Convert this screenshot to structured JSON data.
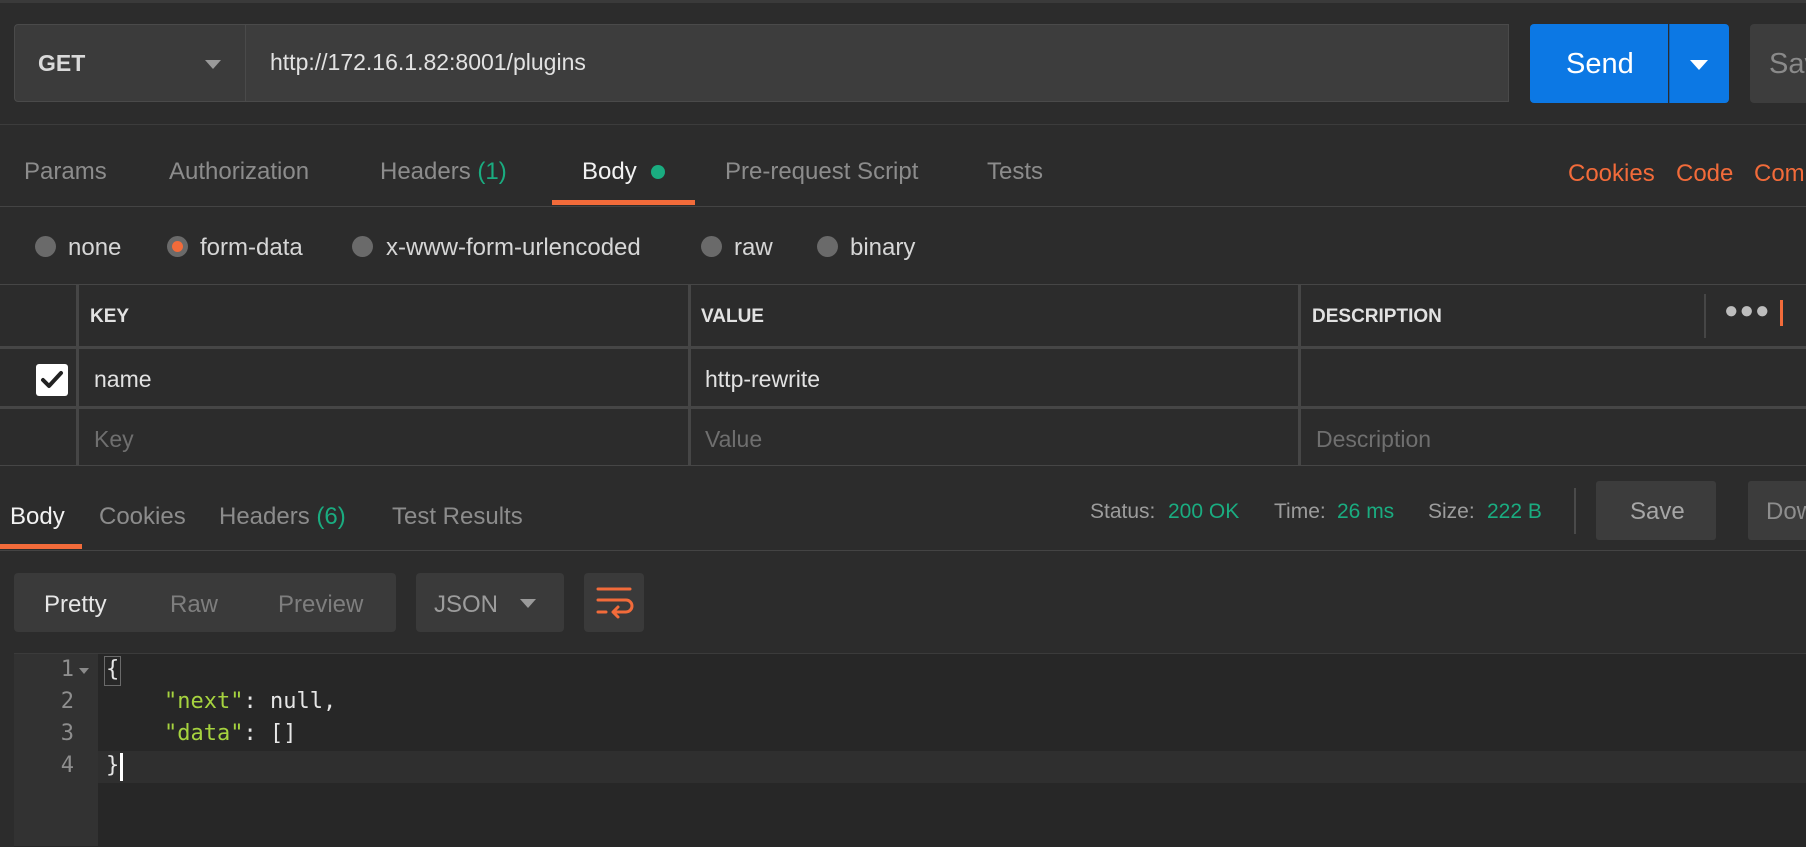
{
  "request": {
    "method": "GET",
    "url": "http://172.16.1.82:8001/plugins",
    "send_label": "Send",
    "save_label": "Save"
  },
  "request_tabs": {
    "params": "Params",
    "authorization": "Authorization",
    "headers": "Headers",
    "headers_count": "(1)",
    "body": "Body",
    "pre_request": "Pre-request Script",
    "tests": "Tests"
  },
  "right_links": {
    "cookies": "Cookies",
    "code": "Code",
    "comments": "Comments"
  },
  "body_types": {
    "selected": "form-data",
    "options": [
      "none",
      "form-data",
      "x-www-form-urlencoded",
      "raw",
      "binary"
    ]
  },
  "form_table": {
    "headers": {
      "key": "KEY",
      "value": "VALUE",
      "description": "DESCRIPTION"
    },
    "more_icon": "ellipsis-icon",
    "rows": [
      {
        "checked": true,
        "key": "name",
        "value": "http-rewrite",
        "description": ""
      }
    ],
    "placeholders": {
      "key": "Key",
      "value": "Value",
      "description": "Description"
    }
  },
  "response_tabs": {
    "body": "Body",
    "cookies": "Cookies",
    "headers": "Headers",
    "headers_count": "(6)",
    "test_results": "Test Results"
  },
  "status": {
    "status_label": "Status:",
    "status_value": "200 OK",
    "time_label": "Time:",
    "time_value": "26 ms",
    "size_label": "Size:",
    "size_value": "222 B"
  },
  "response_actions": {
    "save": "Save",
    "download": "Download"
  },
  "view_modes": {
    "pretty": "Pretty",
    "raw": "Raw",
    "preview": "Preview",
    "selected": "Pretty"
  },
  "format": {
    "selected": "JSON",
    "wrap_icon": "wrap-lines-icon"
  },
  "response_body": {
    "lines": [
      {
        "n": "1",
        "open": "{"
      },
      {
        "n": "2",
        "key": "\"next\"",
        "sep": ": ",
        "val": "null,"
      },
      {
        "n": "3",
        "key": "\"data\"",
        "sep": ": ",
        "val": "[]"
      },
      {
        "n": "4",
        "close": "}"
      }
    ]
  },
  "colors": {
    "background": "#2c2c2c",
    "accent_orange": "#f26b3a",
    "send_blue": "#0c78e4",
    "status_green": "#1aac80",
    "json_string": "#a6d33f"
  }
}
